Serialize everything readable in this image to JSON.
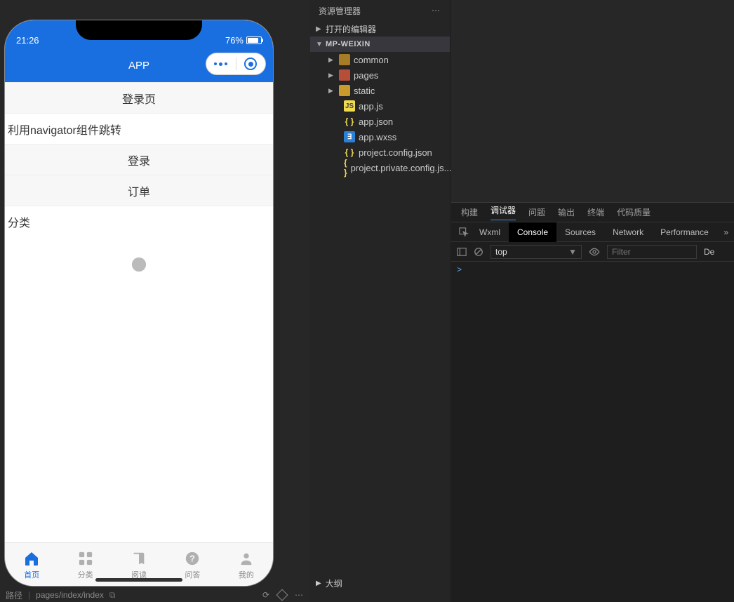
{
  "statusbar": {
    "time": "21:26",
    "battery_pct": "76%"
  },
  "navbar": {
    "title": "APP"
  },
  "page": {
    "items": [
      {
        "label": "登录页",
        "align": "center"
      },
      {
        "label": "利用navigator组件跳转",
        "align": "left"
      },
      {
        "label": "登录",
        "align": "center"
      },
      {
        "label": "订单",
        "align": "center"
      },
      {
        "label": "分类",
        "align": "left"
      }
    ]
  },
  "tabbar": [
    {
      "label": "首页",
      "icon": "home",
      "active": true
    },
    {
      "label": "分类",
      "icon": "grid",
      "active": false
    },
    {
      "label": "阅读",
      "icon": "read",
      "active": false
    },
    {
      "label": "问答",
      "icon": "qa",
      "active": false
    },
    {
      "label": "我的",
      "icon": "me",
      "active": false
    }
  ],
  "explorer": {
    "title": "资源管理器",
    "sections": {
      "open_editors": "打开的编辑器",
      "root": "MP-WEIXIN",
      "outline": "大纲"
    },
    "tree": [
      {
        "type": "folder",
        "name": "common",
        "icon": "folder"
      },
      {
        "type": "folder",
        "name": "pages",
        "icon": "folder-r"
      },
      {
        "type": "folder",
        "name": "static",
        "icon": "folder-y"
      },
      {
        "type": "file",
        "name": "app.js",
        "icon": "js"
      },
      {
        "type": "file",
        "name": "app.json",
        "icon": "json"
      },
      {
        "type": "file",
        "name": "app.wxss",
        "icon": "wxss"
      },
      {
        "type": "file",
        "name": "project.config.json",
        "icon": "json"
      },
      {
        "type": "file",
        "name": "project.private.config.js...",
        "icon": "json"
      }
    ]
  },
  "devtools": {
    "outer_tabs": [
      "构建",
      "调试器",
      "问题",
      "输出",
      "终端",
      "代码质量"
    ],
    "outer_active": 1,
    "inner_tabs": [
      "Wxml",
      "Console",
      "Sources",
      "Network",
      "Performance"
    ],
    "inner_active": 1,
    "context": "top",
    "filter_placeholder": "Filter",
    "trailing": "De",
    "prompt": ">"
  },
  "statusline": {
    "left0": "路径",
    "path": "pages/index/index"
  }
}
